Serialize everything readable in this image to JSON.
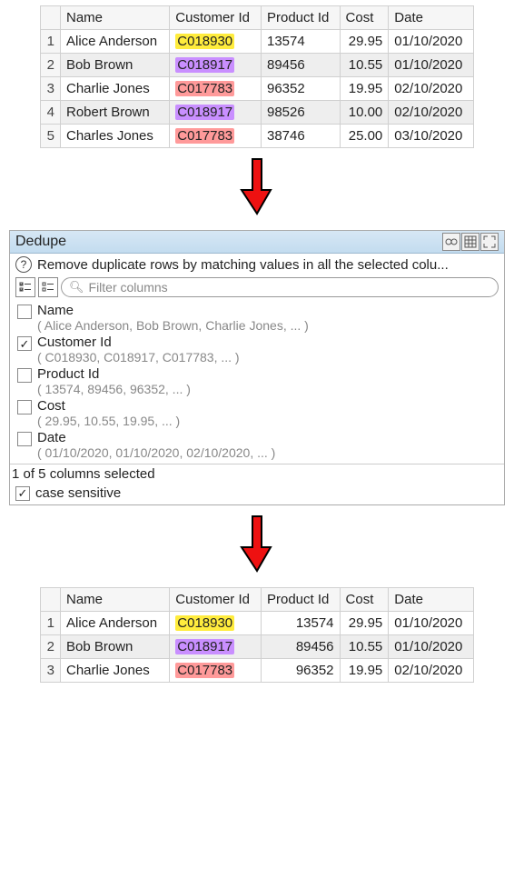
{
  "tableTop": {
    "headers": [
      "",
      "Name",
      "Customer Id",
      "Product Id",
      "Cost",
      "Date"
    ],
    "rows": [
      {
        "n": "1",
        "name": "Alice Anderson",
        "cid": "C018930",
        "cidHi": "yellow",
        "pid": "13574",
        "cost": "29.95",
        "date": "01/10/2020"
      },
      {
        "n": "2",
        "name": "Bob Brown",
        "cid": "C018917",
        "cidHi": "purple",
        "pid": "89456",
        "cost": "10.55",
        "date": "01/10/2020"
      },
      {
        "n": "3",
        "name": "Charlie Jones",
        "cid": "C017783",
        "cidHi": "pink",
        "pid": "96352",
        "cost": "19.95",
        "date": "02/10/2020"
      },
      {
        "n": "4",
        "name": "Robert Brown",
        "cid": "C018917",
        "cidHi": "purple",
        "pid": "98526",
        "cost": "10.00",
        "date": "02/10/2020"
      },
      {
        "n": "5",
        "name": "Charles Jones",
        "cid": "C017783",
        "cidHi": "pink",
        "pid": "38746",
        "cost": "25.00",
        "date": "03/10/2020"
      }
    ]
  },
  "panel": {
    "title": "Dedupe",
    "desc": "Remove duplicate rows by matching values in all the selected colu...",
    "filterPlaceholder": "Filter columns",
    "columns": [
      {
        "name": "Name",
        "hint": "( Alice Anderson, Bob Brown, Charlie Jones, ... )",
        "checked": false
      },
      {
        "name": "Customer Id",
        "hint": "( C018930, C018917, C017783, ... )",
        "checked": true
      },
      {
        "name": "Product Id",
        "hint": "( 13574, 89456, 96352, ... )",
        "checked": false
      },
      {
        "name": "Cost",
        "hint": "( 29.95, 10.55, 19.95, ... )",
        "checked": false
      },
      {
        "name": "Date",
        "hint": "( 01/10/2020, 01/10/2020, 02/10/2020, ... )",
        "checked": false
      }
    ],
    "status": "1 of 5 columns selected",
    "caseSensitive": {
      "label": "case sensitive",
      "checked": true
    }
  },
  "tableBottom": {
    "headers": [
      "",
      "Name",
      "Customer Id",
      "Product Id",
      "Cost",
      "Date"
    ],
    "rows": [
      {
        "n": "1",
        "name": "Alice Anderson",
        "cid": "C018930",
        "cidHi": "yellow",
        "pid": "13574",
        "cost": "29.95",
        "date": "01/10/2020"
      },
      {
        "n": "2",
        "name": "Bob Brown",
        "cid": "C018917",
        "cidHi": "purple",
        "pid": "89456",
        "cost": "10.55",
        "date": "01/10/2020"
      },
      {
        "n": "3",
        "name": "Charlie Jones",
        "cid": "C017783",
        "cidHi": "pink",
        "pid": "96352",
        "cost": "19.95",
        "date": "02/10/2020"
      }
    ]
  }
}
